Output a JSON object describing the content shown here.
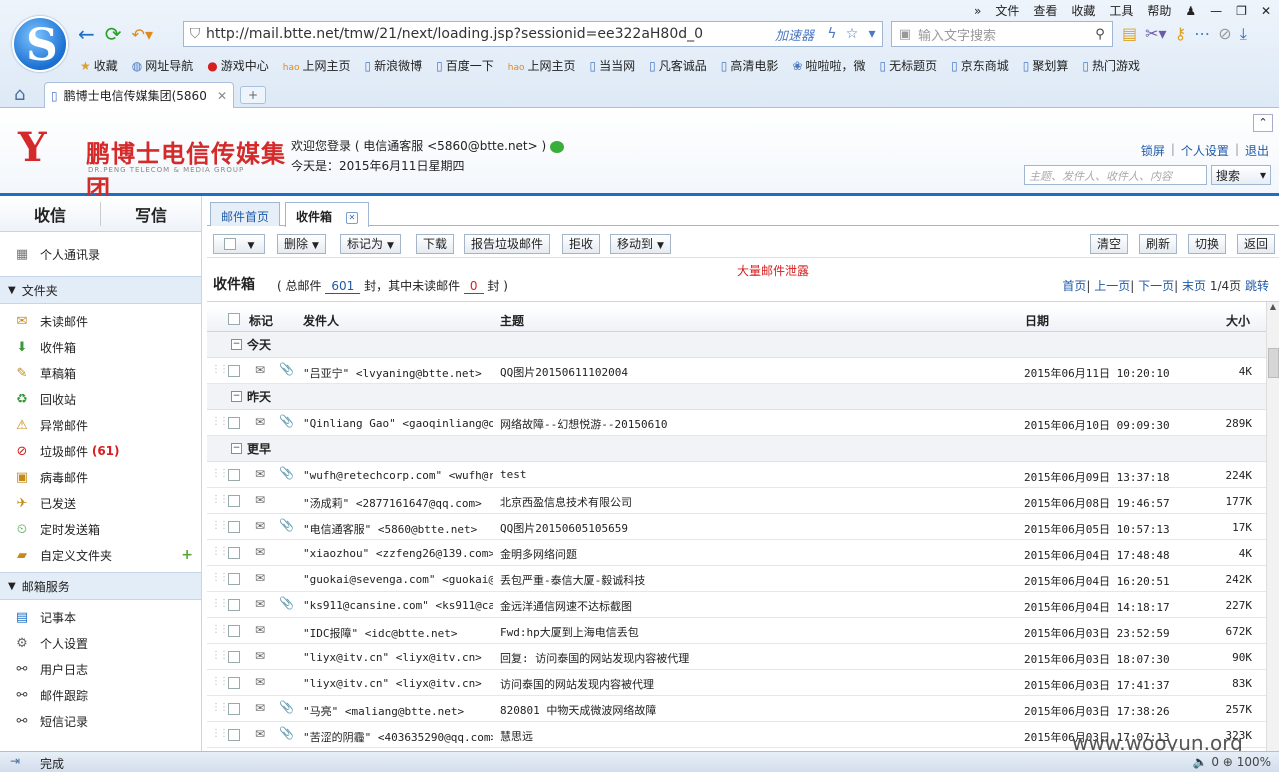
{
  "browser": {
    "menu": [
      "文件",
      "查看",
      "收藏",
      "工具",
      "帮助"
    ],
    "url": "http://mail.btte.net/tmw/21/next/loading.jsp?sessionid=ee322aH80d_0",
    "accelerator": "加速器",
    "search_placeholder": "输入文字搜索",
    "favorites": [
      "收藏",
      "网址导航",
      "游戏中心",
      "上网主页",
      "新浪微博",
      "百度一下",
      "上网主页",
      "当当网",
      "凡客诚品",
      "高清电影",
      "啦啦啦，微",
      "无标题页",
      "京东商城",
      "聚划算",
      "热门游戏"
    ],
    "tab_title": "鹏博士电信传媒集团(5860",
    "status_text": "完成",
    "zoom": "100%",
    "status_count": "0"
  },
  "mail_header": {
    "brand_cn": "鹏博士电信传媒集团",
    "brand_en": "DR.PENG TELECOM & MEDIA GROUP",
    "welcome_line": "欢迎您登录 ( 电信通客服  <5860@btte.net> )",
    "date_line": "今天是：2015年6月11日星期四",
    "links": [
      "锁屏",
      "个人设置",
      "退出"
    ],
    "search_placeholder": "主题、发件人、收件人、内容",
    "search_button": "搜索"
  },
  "sidebar": {
    "receive": "收信",
    "compose": "写信",
    "contacts": "个人通讯录",
    "folders_title": "文件夹",
    "folders": [
      {
        "label": "未读邮件",
        "icon": "unread-icon"
      },
      {
        "label": "收件箱",
        "icon": "inbox-icon"
      },
      {
        "label": "草稿箱",
        "icon": "drafts-icon"
      },
      {
        "label": "回收站",
        "icon": "trash-icon"
      },
      {
        "label": "异常邮件",
        "icon": "warning-icon"
      },
      {
        "label": "垃圾邮件",
        "icon": "spam-icon",
        "count": "(61)"
      },
      {
        "label": "病毒邮件",
        "icon": "virus-icon"
      },
      {
        "label": "已发送",
        "icon": "sent-icon"
      },
      {
        "label": "定时发送箱",
        "icon": "scheduled-icon"
      },
      {
        "label": "自定义文件夹",
        "icon": "custom-folder-icon"
      }
    ],
    "services_title": "邮箱服务",
    "services": [
      {
        "label": "记事本",
        "icon": "notebook-icon"
      },
      {
        "label": "个人设置",
        "icon": "settings-icon"
      },
      {
        "label": "用户日志",
        "icon": "log-icon"
      },
      {
        "label": "邮件跟踪",
        "icon": "tracking-icon"
      },
      {
        "label": "短信记录",
        "icon": "sms-icon"
      }
    ]
  },
  "content": {
    "tabs": [
      "邮件首页",
      "收件箱"
    ],
    "toolbar": {
      "delete": "删除",
      "mark_as": "标记为",
      "download": "下载",
      "report_spam": "报告垃圾邮件",
      "reject": "拒收",
      "move_to": "移动到",
      "clear": "清空",
      "refresh": "刷新",
      "switch": "切换",
      "back": "返回"
    },
    "list_title": "收件箱",
    "total_prefix": "( 总邮件",
    "total": "601",
    "unread_prefix": "封，其中未读邮件",
    "unread": "0",
    "unread_suffix": "封 )",
    "annotation": "大量邮件泄露",
    "pager": {
      "first": "首页",
      "prev": "上一页",
      "next": "下一页",
      "last": "末页",
      "page": "1/4页",
      "jump": "跳转"
    },
    "columns": {
      "mark": "标记",
      "from": "发件人",
      "subject": "主题",
      "date": "日期",
      "size": "大小"
    },
    "groups": [
      {
        "label": "今天",
        "rows": [
          {
            "from": "\"吕亚宁\" <lvyaning@btte.net>",
            "subject": "QQ图片20150611102004",
            "date": "2015年06月11日 10:20:10",
            "size": "4K",
            "attach": true
          }
        ]
      },
      {
        "label": "昨天",
        "rows": [
          {
            "from": "\"Qinliang Gao\" <gaoqinliang@o…",
            "subject": "网络故障--幻想悦游--20150610",
            "date": "2015年06月10日 09:09:30",
            "size": "289K",
            "attach": true
          }
        ]
      },
      {
        "label": "更早",
        "rows": [
          {
            "from": "\"wufh@retechcorp.com\" <wufh@r…",
            "subject": "test",
            "date": "2015年06月09日 13:37:18",
            "size": "224K",
            "attach": true
          },
          {
            "from": "\"汤成莉\" <2877161647@qq.com>",
            "subject": "北京西盈信息技术有限公司",
            "date": "2015年06月08日 19:46:57",
            "size": "177K",
            "attach": false
          },
          {
            "from": "\"电信通客服\" <5860@btte.net>",
            "subject": "QQ图片20150605105659",
            "date": "2015年06月05日 10:57:13",
            "size": "17K",
            "attach": true
          },
          {
            "from": "\"xiaozhou\" <zzfeng26@139.com>",
            "subject": "金明多网络问题",
            "date": "2015年06月04日 17:48:48",
            "size": "4K",
            "attach": false
          },
          {
            "from": "\"guokai@sevenga.com\" <guokai@…",
            "subject": "丢包严重-泰信大厦-毅诚科技",
            "date": "2015年06月04日 16:20:51",
            "size": "242K",
            "attach": false
          },
          {
            "from": "\"ks911@cansine.com\" <ks911@ca…",
            "subject": "金远洋通信网速不达标截图",
            "date": "2015年06月04日 14:18:17",
            "size": "227K",
            "attach": true
          },
          {
            "from": "\"IDC报障\" <idc@btte.net>",
            "subject": "Fwd:hp大厦到上海电信丢包",
            "date": "2015年06月03日 23:52:59",
            "size": "672K",
            "attach": false
          },
          {
            "from": "\"liyx@itv.cn\" <liyx@itv.cn>",
            "subject": "回复: 访问泰国的网站发现内容被代理",
            "date": "2015年06月03日 18:07:30",
            "size": "90K",
            "attach": false
          },
          {
            "from": "\"liyx@itv.cn\" <liyx@itv.cn>",
            "subject": "访问泰国的网站发现内容被代理",
            "date": "2015年06月03日 17:41:37",
            "size": "83K",
            "attach": false
          },
          {
            "from": "\"马亮\" <maliang@btte.net>",
            "subject": "820801 中物天成微波网络故障",
            "date": "2015年06月03日 17:38:26",
            "size": "257K",
            "attach": true
          },
          {
            "from": "\"苦涩的阴霾\" <403635290@qq.com>",
            "subject": "慧思远",
            "date": "2015年06月03日 17:07:13",
            "size": "323K",
            "attach": true
          }
        ]
      }
    ]
  },
  "watermark": "www.wooyun.org"
}
